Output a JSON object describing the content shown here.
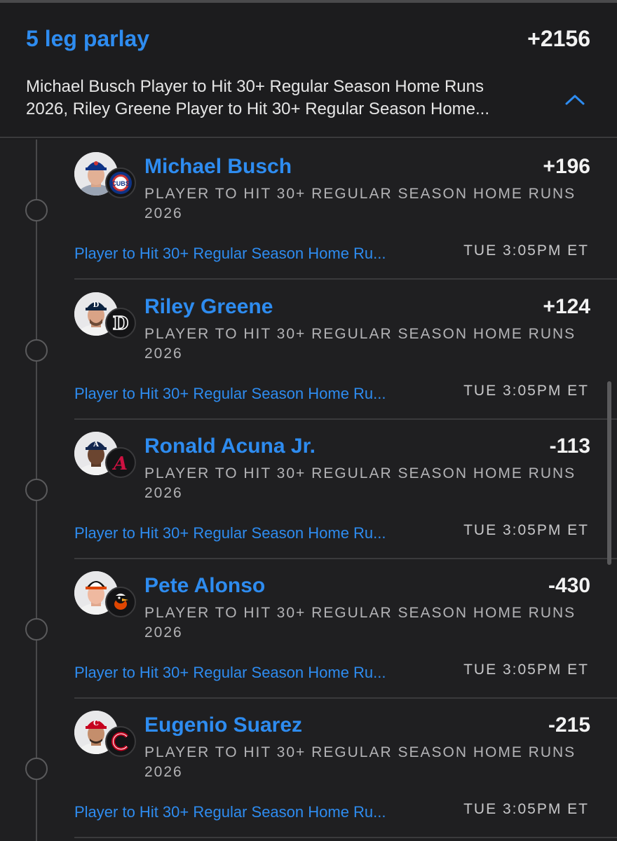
{
  "parlay": {
    "title": "5 leg parlay",
    "odds": "+2156",
    "description_line1": "Michael Busch Player to Hit 30+ Regular Season Home Runs",
    "description_line2": "2026, Riley Greene Player to Hit 30+ Regular Season Home...",
    "expanded_icon": "chevron-up-icon"
  },
  "legs": [
    {
      "player": "Michael Busch",
      "odds": "+196",
      "market": "PLAYER TO HIT 30+ REGULAR SEASON HOME RUNS 2026",
      "link": "Player to Hit 30+ Regular Season Home Ru...",
      "time": "TUE 3:05PM ET",
      "team_logo": "cubs-logo",
      "team_color": "#0e3386"
    },
    {
      "player": "Riley Greene",
      "odds": "+124",
      "market": "PLAYER TO HIT 30+ REGULAR SEASON HOME RUNS 2026",
      "link": "Player to Hit 30+ Regular Season Home Ru...",
      "time": "TUE 3:05PM ET",
      "team_logo": "tigers-logo",
      "team_color": "#ffffff"
    },
    {
      "player": "Ronald Acuna Jr.",
      "odds": "-113",
      "market": "PLAYER TO HIT 30+ REGULAR SEASON HOME RUNS 2026",
      "link": "Player to Hit 30+ Regular Season Home Ru...",
      "time": "TUE 3:05PM ET",
      "team_logo": "braves-logo",
      "team_color": "#ce1141"
    },
    {
      "player": "Pete Alonso",
      "odds": "-430",
      "market": "PLAYER TO HIT 30+ REGULAR SEASON HOME RUNS 2026",
      "link": "Player to Hit 30+ Regular Season Home Ru...",
      "time": "TUE 3:05PM ET",
      "team_logo": "orioles-logo",
      "team_color": "#df4601"
    },
    {
      "player": "Eugenio Suarez",
      "odds": "-215",
      "market": "PLAYER TO HIT 30+ REGULAR SEASON HOME RUNS 2026",
      "link": "Player to Hit 30+ Regular Season Home Ru...",
      "time": "TUE 3:05PM ET",
      "team_logo": "reds-logo",
      "team_color": "#c6011f"
    }
  ],
  "theme": {
    "background": "#1c1c1e",
    "accent": "#2e8cf0",
    "text": "#f2f2f2",
    "muted": "#b3b3b6"
  }
}
